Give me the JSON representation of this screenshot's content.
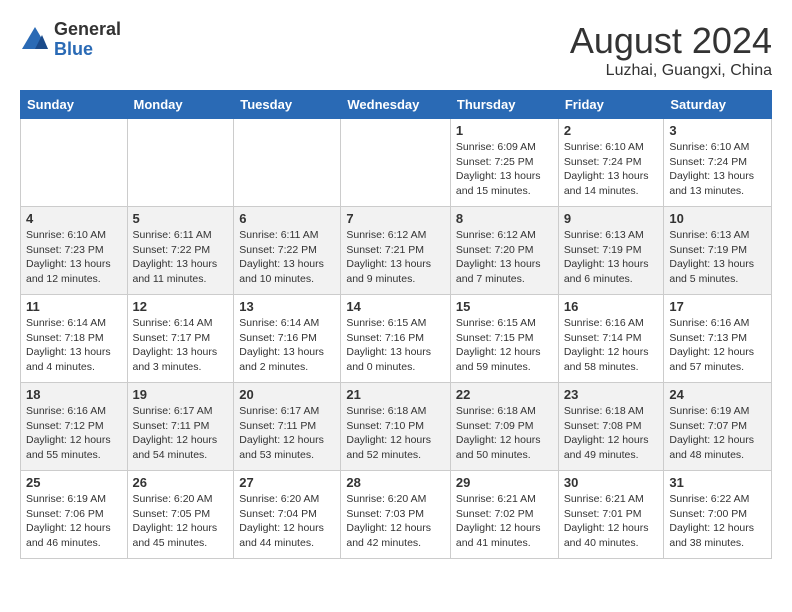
{
  "header": {
    "logo_general": "General",
    "logo_blue": "Blue",
    "month_year": "August 2024",
    "location": "Luzhai, Guangxi, China"
  },
  "days_of_week": [
    "Sunday",
    "Monday",
    "Tuesday",
    "Wednesday",
    "Thursday",
    "Friday",
    "Saturday"
  ],
  "weeks": [
    [
      {
        "day": "",
        "info": ""
      },
      {
        "day": "",
        "info": ""
      },
      {
        "day": "",
        "info": ""
      },
      {
        "day": "",
        "info": ""
      },
      {
        "day": "1",
        "info": "Sunrise: 6:09 AM\nSunset: 7:25 PM\nDaylight: 13 hours\nand 15 minutes."
      },
      {
        "day": "2",
        "info": "Sunrise: 6:10 AM\nSunset: 7:24 PM\nDaylight: 13 hours\nand 14 minutes."
      },
      {
        "day": "3",
        "info": "Sunrise: 6:10 AM\nSunset: 7:24 PM\nDaylight: 13 hours\nand 13 minutes."
      }
    ],
    [
      {
        "day": "4",
        "info": "Sunrise: 6:10 AM\nSunset: 7:23 PM\nDaylight: 13 hours\nand 12 minutes."
      },
      {
        "day": "5",
        "info": "Sunrise: 6:11 AM\nSunset: 7:22 PM\nDaylight: 13 hours\nand 11 minutes."
      },
      {
        "day": "6",
        "info": "Sunrise: 6:11 AM\nSunset: 7:22 PM\nDaylight: 13 hours\nand 10 minutes."
      },
      {
        "day": "7",
        "info": "Sunrise: 6:12 AM\nSunset: 7:21 PM\nDaylight: 13 hours\nand 9 minutes."
      },
      {
        "day": "8",
        "info": "Sunrise: 6:12 AM\nSunset: 7:20 PM\nDaylight: 13 hours\nand 7 minutes."
      },
      {
        "day": "9",
        "info": "Sunrise: 6:13 AM\nSunset: 7:19 PM\nDaylight: 13 hours\nand 6 minutes."
      },
      {
        "day": "10",
        "info": "Sunrise: 6:13 AM\nSunset: 7:19 PM\nDaylight: 13 hours\nand 5 minutes."
      }
    ],
    [
      {
        "day": "11",
        "info": "Sunrise: 6:14 AM\nSunset: 7:18 PM\nDaylight: 13 hours\nand 4 minutes."
      },
      {
        "day": "12",
        "info": "Sunrise: 6:14 AM\nSunset: 7:17 PM\nDaylight: 13 hours\nand 3 minutes."
      },
      {
        "day": "13",
        "info": "Sunrise: 6:14 AM\nSunset: 7:16 PM\nDaylight: 13 hours\nand 2 minutes."
      },
      {
        "day": "14",
        "info": "Sunrise: 6:15 AM\nSunset: 7:16 PM\nDaylight: 13 hours\nand 0 minutes."
      },
      {
        "day": "15",
        "info": "Sunrise: 6:15 AM\nSunset: 7:15 PM\nDaylight: 12 hours\nand 59 minutes."
      },
      {
        "day": "16",
        "info": "Sunrise: 6:16 AM\nSunset: 7:14 PM\nDaylight: 12 hours\nand 58 minutes."
      },
      {
        "day": "17",
        "info": "Sunrise: 6:16 AM\nSunset: 7:13 PM\nDaylight: 12 hours\nand 57 minutes."
      }
    ],
    [
      {
        "day": "18",
        "info": "Sunrise: 6:16 AM\nSunset: 7:12 PM\nDaylight: 12 hours\nand 55 minutes."
      },
      {
        "day": "19",
        "info": "Sunrise: 6:17 AM\nSunset: 7:11 PM\nDaylight: 12 hours\nand 54 minutes."
      },
      {
        "day": "20",
        "info": "Sunrise: 6:17 AM\nSunset: 7:11 PM\nDaylight: 12 hours\nand 53 minutes."
      },
      {
        "day": "21",
        "info": "Sunrise: 6:18 AM\nSunset: 7:10 PM\nDaylight: 12 hours\nand 52 minutes."
      },
      {
        "day": "22",
        "info": "Sunrise: 6:18 AM\nSunset: 7:09 PM\nDaylight: 12 hours\nand 50 minutes."
      },
      {
        "day": "23",
        "info": "Sunrise: 6:18 AM\nSunset: 7:08 PM\nDaylight: 12 hours\nand 49 minutes."
      },
      {
        "day": "24",
        "info": "Sunrise: 6:19 AM\nSunset: 7:07 PM\nDaylight: 12 hours\nand 48 minutes."
      }
    ],
    [
      {
        "day": "25",
        "info": "Sunrise: 6:19 AM\nSunset: 7:06 PM\nDaylight: 12 hours\nand 46 minutes."
      },
      {
        "day": "26",
        "info": "Sunrise: 6:20 AM\nSunset: 7:05 PM\nDaylight: 12 hours\nand 45 minutes."
      },
      {
        "day": "27",
        "info": "Sunrise: 6:20 AM\nSunset: 7:04 PM\nDaylight: 12 hours\nand 44 minutes."
      },
      {
        "day": "28",
        "info": "Sunrise: 6:20 AM\nSunset: 7:03 PM\nDaylight: 12 hours\nand 42 minutes."
      },
      {
        "day": "29",
        "info": "Sunrise: 6:21 AM\nSunset: 7:02 PM\nDaylight: 12 hours\nand 41 minutes."
      },
      {
        "day": "30",
        "info": "Sunrise: 6:21 AM\nSunset: 7:01 PM\nDaylight: 12 hours\nand 40 minutes."
      },
      {
        "day": "31",
        "info": "Sunrise: 6:22 AM\nSunset: 7:00 PM\nDaylight: 12 hours\nand 38 minutes."
      }
    ]
  ]
}
